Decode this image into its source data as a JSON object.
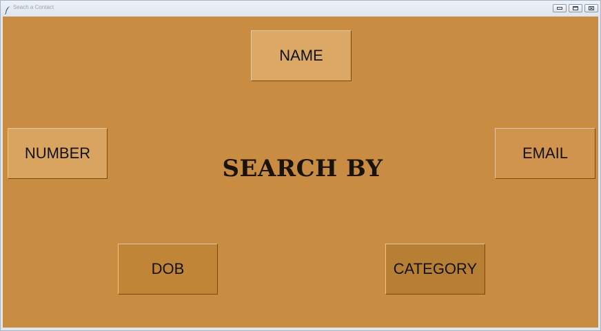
{
  "window": {
    "title": "Seach a Contact",
    "icon": "feather-icon",
    "controls": [
      "minimize-icon",
      "maximize-icon",
      "close-icon"
    ]
  },
  "main": {
    "heading": "SEARCH BY",
    "buttons": {
      "name": "NAME",
      "number": "NUMBER",
      "email": "EMAIL",
      "dob": "DOB",
      "category": "CATEGORY"
    }
  },
  "colors": {
    "background": "#c88c42",
    "name_button": "#dba965",
    "number_button": "#d8a460",
    "email_button": "#d0944e",
    "dob_button": "#c18538",
    "category_button": "#b77f34"
  }
}
